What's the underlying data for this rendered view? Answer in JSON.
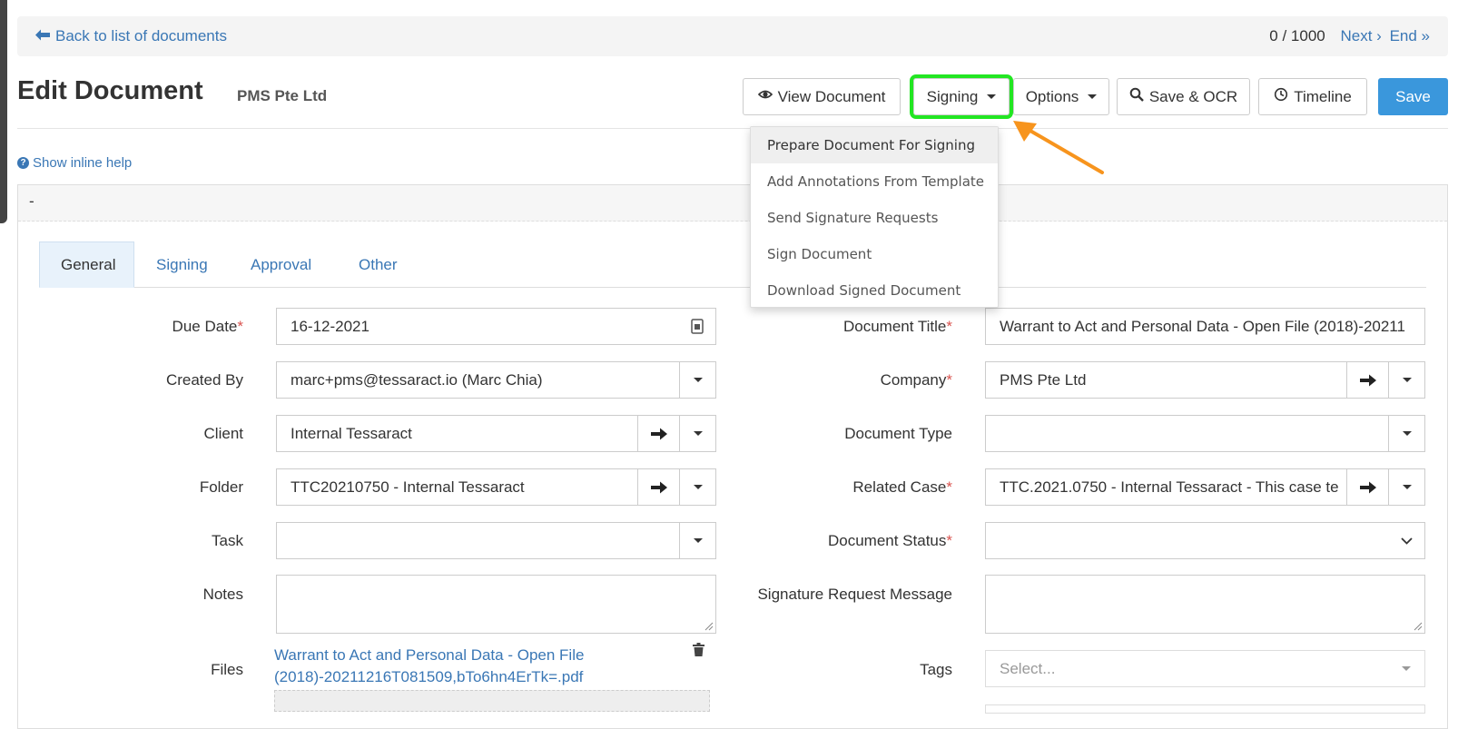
{
  "nav": {
    "back_label": "Back to list of documents",
    "pager_count": "0 / 1000",
    "next_label": "Next ›",
    "end_label": "End »"
  },
  "header": {
    "title": "Edit Document",
    "company": "PMS Pte Ltd"
  },
  "toolbar": {
    "view_document": "View Document",
    "signing": "Signing",
    "options": "Options",
    "save_ocr": "Save & OCR",
    "timeline": "Timeline",
    "save": "Save"
  },
  "signing_menu": {
    "items": [
      "Prepare Document For Signing",
      "Add Annotations From Template",
      "Send Signature Requests",
      "Sign Document",
      "Download Signed Document"
    ]
  },
  "help": {
    "label": "Show inline help"
  },
  "panel": {
    "heading": "-"
  },
  "tabs": [
    "General",
    "Signing",
    "Approval",
    "Other"
  ],
  "form_left": {
    "due_date_label": "Due Date",
    "due_date_value": "16-12-2021",
    "created_by_label": "Created By",
    "created_by_value": "marc+pms@tessaract.io (Marc Chia)",
    "client_label": "Client",
    "client_value": "Internal Tessaract",
    "folder_label": "Folder",
    "folder_value": "TTC20210750 - Internal Tessaract",
    "task_label": "Task",
    "task_value": "",
    "notes_label": "Notes",
    "files_label": "Files",
    "file_name": "Warrant to Act and Personal Data - Open File (2018)-20211216T081509,bTo6hn4ErTk=.pdf"
  },
  "form_right": {
    "document_title_label": "Document Title",
    "document_title_value": "Warrant to Act and Personal Data - Open File (2018)-20211",
    "company_label": "Company",
    "company_value": "PMS Pte Ltd",
    "document_type_label": "Document Type",
    "document_type_value": "",
    "related_case_label": "Related Case",
    "related_case_value": "TTC.2021.0750 - Internal Tessaract - This case te",
    "document_status_label": "Document Status",
    "document_status_value": "",
    "signature_message_label": "Signature Request Message",
    "tags_label": "Tags",
    "tags_placeholder": "Select..."
  },
  "required_marker": "*",
  "colors": {
    "highlight_border": "#22e622",
    "annotation_arrow": "#f7941d",
    "primary": "#3a97dc",
    "link": "#3a77b5"
  }
}
